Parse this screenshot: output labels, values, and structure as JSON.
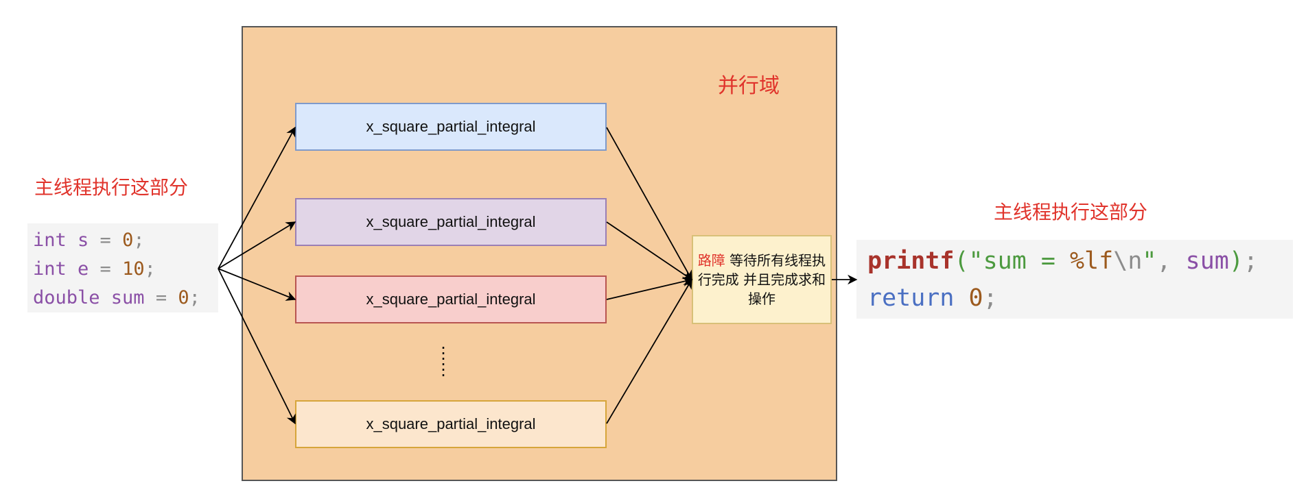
{
  "left_section": {
    "label": "主线程执行这部分",
    "code": [
      {
        "tokens": [
          {
            "t": "int s",
            "c": "#8a4fa6"
          },
          {
            "t": " = ",
            "c": "#8c8c8c"
          },
          {
            "t": "0",
            "c": "#9c5a1e"
          },
          {
            "t": ";",
            "c": "#8c8c8c"
          }
        ]
      },
      {
        "tokens": [
          {
            "t": "int e",
            "c": "#8a4fa6"
          },
          {
            "t": " = ",
            "c": "#8c8c8c"
          },
          {
            "t": "10",
            "c": "#9c5a1e"
          },
          {
            "t": ";",
            "c": "#8c8c8c"
          }
        ]
      },
      {
        "tokens": [
          {
            "t": "double sum",
            "c": "#8a4fa6"
          },
          {
            "t": " = ",
            "c": "#8c8c8c"
          },
          {
            "t": "0",
            "c": "#9c5a1e"
          },
          {
            "t": ";",
            "c": "#8c8c8c"
          }
        ]
      }
    ]
  },
  "parallel_region": {
    "label": "并行域",
    "tasks": [
      {
        "label": "x_square_partial_integral",
        "fill": "#dae8fc",
        "stroke": "#7e9acb"
      },
      {
        "label": "x_square_partial_integral",
        "fill": "#e1d5e7",
        "stroke": "#9a7fb5"
      },
      {
        "label": "x_square_partial_integral",
        "fill": "#f8cecc",
        "stroke": "#b85450"
      },
      {
        "label": "x_square_partial_integral",
        "fill": "#fce6cd",
        "stroke": "#d6a53a"
      }
    ],
    "ellipsis": "⋮",
    "barrier": {
      "keyword": "路障",
      "text": " 等待所有线程执行完成 并且完成求和操作"
    }
  },
  "right_section": {
    "label": "主线程执行这部分",
    "code": [
      {
        "tokens": [
          {
            "t": "printf",
            "c": "#a8332b",
            "b": true
          },
          {
            "t": "(",
            "c": "#4c9a3f"
          },
          {
            "t": "\"sum = ",
            "c": "#4c9a3f"
          },
          {
            "t": "%lf",
            "c": "#9c5a1e"
          },
          {
            "t": "\\n",
            "c": "#8c8c8c"
          },
          {
            "t": "\"",
            "c": "#4c9a3f"
          },
          {
            "t": ", ",
            "c": "#8c8c8c"
          },
          {
            "t": "sum",
            "c": "#8a4fa6"
          },
          {
            "t": ")",
            "c": "#4c9a3f"
          },
          {
            "t": ";",
            "c": "#8c8c8c"
          }
        ]
      },
      {
        "tokens": [
          {
            "t": "return ",
            "c": "#4a6fc2"
          },
          {
            "t": "0",
            "c": "#9c5a1e"
          },
          {
            "t": ";",
            "c": "#8c8c8c"
          }
        ]
      }
    ]
  }
}
